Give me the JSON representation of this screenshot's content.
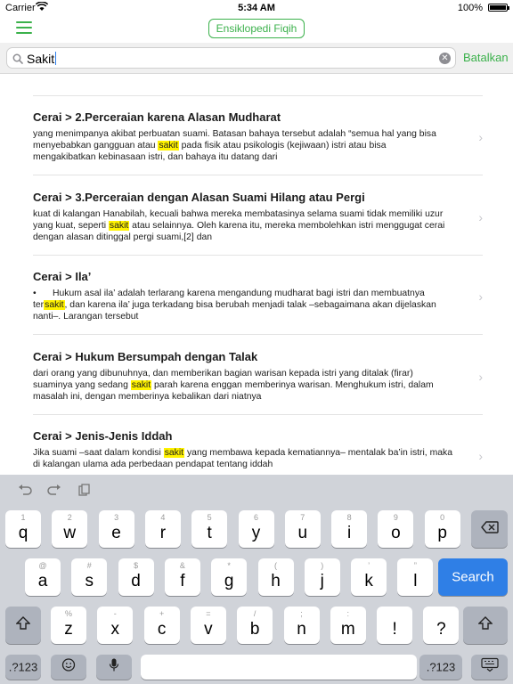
{
  "status": {
    "carrier": "Carrier",
    "time": "5:34 AM",
    "battery": "100%",
    "battery_level": 1.0
  },
  "navbar": {
    "title": "Ensiklopedi Fiqih",
    "menu_icon": "hamburger-icon",
    "accent": "#3bb14b"
  },
  "search": {
    "value": "Sakit",
    "cancel_label": "Batalkan",
    "clear_icon": "clear-circle-icon",
    "search_icon": "magnifier-icon"
  },
  "results": [
    {
      "title": "Cerai > 2.Perceraian karena Alasan Mudharat",
      "lines": [
        [
          "yang menimpanya akibat perbuatan suami. Batasan bahaya tersebut adalah “semua hal yang bisa"
        ],
        [
          "menyebabkan gangguan atau ",
          "sakit",
          " pada fisik atau psikologis (kejiwaan) istri atau bisa"
        ],
        [
          "mengakibatkan kebinasaan istri, dan bahaya itu datang dari"
        ]
      ]
    },
    {
      "title": "Cerai > 3.Perceraian dengan Alasan Suami Hilang atau Pergi",
      "lines": [
        [
          "kuat di kalangan Hanabilah, kecuali bahwa mereka membatasinya selama suami tidak memiliki uzur"
        ],
        [
          "yang kuat, seperti ",
          "sakit",
          " atau selainnya. Oleh karena itu, mereka membolehkan istri menggugat cerai"
        ],
        [
          "dengan alasan ditinggal pergi suami,[2] dan"
        ]
      ]
    },
    {
      "title": "Cerai > Ila’",
      "lines": [
        [
          "Hukum asal ila’ adalah terlarang karena mengandung mudharat bagi istri dan membuatnya"
        ],
        [
          "ter",
          "sakit",
          ", dan karena ila’ juga terkadang bisa berubah menjadi talak –sebagaimana akan dijelaskan"
        ],
        [
          "nanti–. Larangan tersebut"
        ]
      ]
    },
    {
      "title": "Cerai > Hukum Bersumpah dengan Talak",
      "lines": [
        [
          "dari orang yang dibunuhnya, dan memberikan bagian warisan kepada istri yang ditalak (firar)"
        ],
        [
          "suaminya yang sedang ",
          "sakit",
          " parah karena enggan memberinya warisan. Menghukum istri, dalam"
        ],
        [
          "masalah ini, dengan memberinya kebalikan dari niatnya"
        ]
      ]
    },
    {
      "title": "Cerai > Jenis-Jenis Iddah",
      "lines": [
        [
          "Jika suami –saat dalam kondisi ",
          "sakit",
          " yang membawa kepada kematiannya– mentalak ba’in istri, maka"
        ],
        [
          "di kalangan ulama ada perbedaan pendapat tentang iddah"
        ]
      ]
    }
  ],
  "keyboard": {
    "tools": [
      "undo-icon",
      "redo-icon",
      "paste-icon"
    ],
    "row1": [
      [
        "1",
        "q"
      ],
      [
        "2",
        "w"
      ],
      [
        "3",
        "e"
      ],
      [
        "4",
        "r"
      ],
      [
        "5",
        "t"
      ],
      [
        "6",
        "y"
      ],
      [
        "7",
        "u"
      ],
      [
        "8",
        "i"
      ],
      [
        "9",
        "o"
      ],
      [
        "0",
        "p"
      ]
    ],
    "row2": [
      [
        "@",
        "a"
      ],
      [
        "#",
        "s"
      ],
      [
        "$",
        "d"
      ],
      [
        "&",
        "f"
      ],
      [
        "*",
        "g"
      ],
      [
        "(",
        "h"
      ],
      [
        ")",
        "j"
      ],
      [
        "’",
        "k"
      ],
      [
        "”",
        "l"
      ]
    ],
    "row3": [
      [
        "%",
        "z"
      ],
      [
        "-",
        "x"
      ],
      [
        "+",
        "c"
      ],
      [
        "=",
        "v"
      ],
      [
        "/",
        "b"
      ],
      [
        ";",
        "n"
      ],
      [
        ":",
        "m"
      ],
      [
        "",
        "!"
      ],
      [
        "",
        "?"
      ]
    ],
    "search_label": "Search",
    "numbers_label": ".?123",
    "accent": "#2f7fe6"
  }
}
